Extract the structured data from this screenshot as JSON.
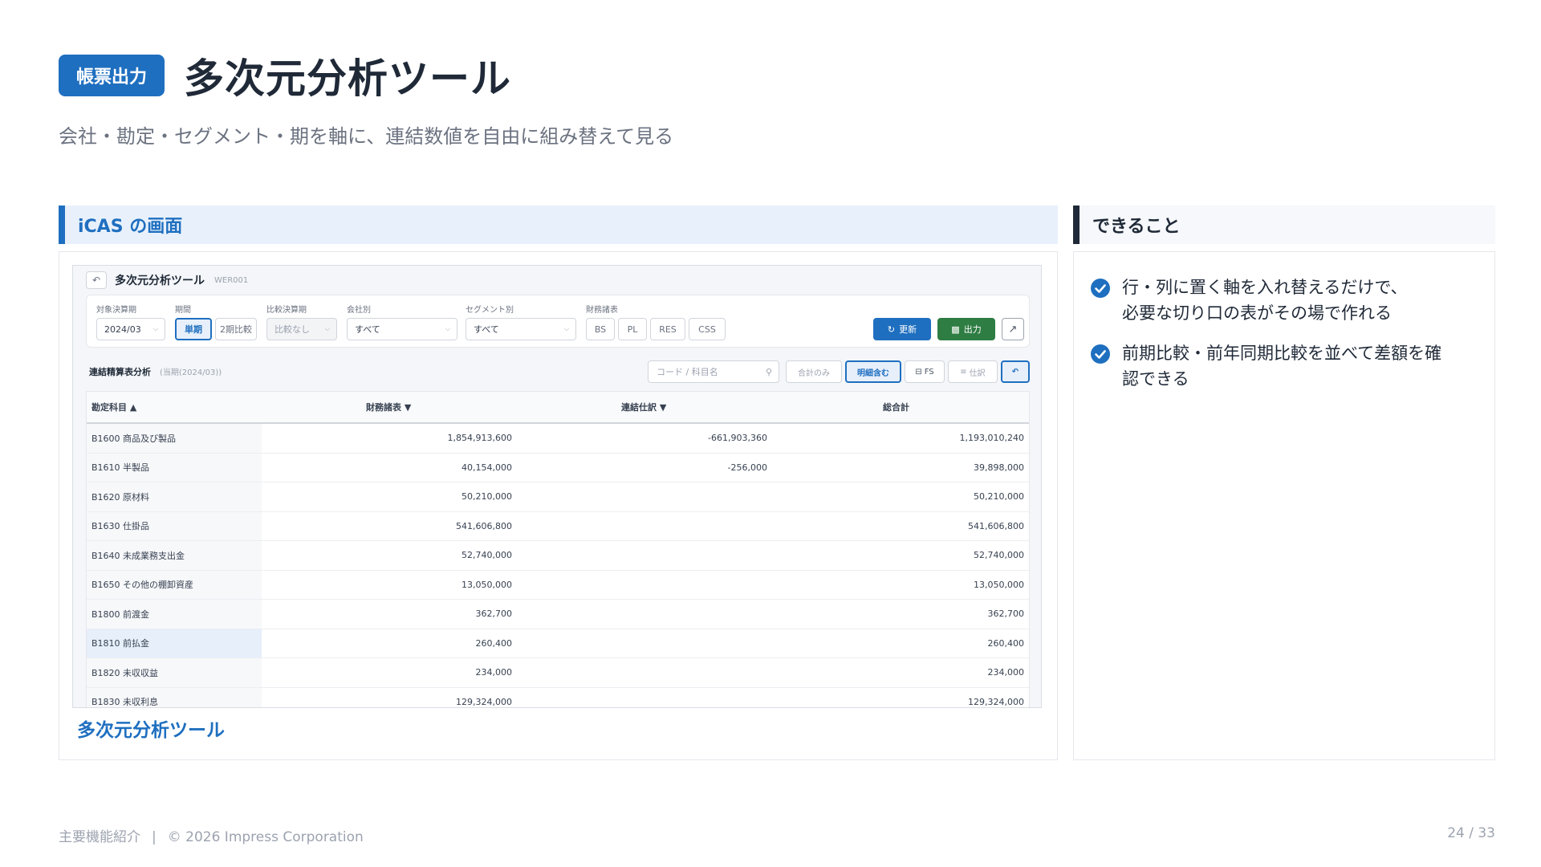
{
  "header": {
    "badge": "帳票出力",
    "title": "多次元分析ツール",
    "subtitle": "会社・勘定・セグメント・期を軸に、連結数値を自由に組み替えて見る"
  },
  "left_panel": {
    "heading": "iCAS の画面",
    "caption": "多次元分析ツール",
    "screenshot": {
      "back_icon": "↶",
      "title": "多次元分析ツール",
      "code": "WER001",
      "filters": {
        "target_label": "対象決算期",
        "target_value": "2024/03",
        "period_label": "期間",
        "period_single": "単期",
        "period_compare": "2期比較",
        "compare_label": "比較決算期",
        "compare_value": "比較なし",
        "company_label": "会社別",
        "company_value": "すべて",
        "segment_label": "セグメント別",
        "segment_value": "すべて",
        "statement_label": "財務諸表",
        "statements": [
          "BS",
          "PL",
          "RES",
          "CSS"
        ],
        "refresh_label": "更新",
        "export_label": "出力"
      },
      "section": {
        "title": "連結精算表分析",
        "subtitle": "(当期(2024/03))",
        "search_placeholder": "コード / 科目名",
        "total_only": "合計のみ",
        "include_detail": "明細含む",
        "fs": "FS",
        "journal": "仕訳"
      },
      "columns": [
        "勘定科目 ▲",
        "財務諸表 ▼",
        "連結仕訳 ▼",
        "総合計"
      ],
      "rows": [
        [
          "B1600 商品及び製品",
          "1,854,913,600",
          "-661,903,360",
          "1,193,010,240"
        ],
        [
          "B1610 半製品",
          "40,154,000",
          "-256,000",
          "39,898,000"
        ],
        [
          "B1620 原材料",
          "50,210,000",
          "",
          "50,210,000"
        ],
        [
          "B1630 仕掛品",
          "541,606,800",
          "",
          "541,606,800"
        ],
        [
          "B1640 未成業務支出金",
          "52,740,000",
          "",
          "52,740,000"
        ],
        [
          "B1650 その他の棚卸資産",
          "13,050,000",
          "",
          "13,050,000"
        ],
        [
          "B1800 前渡金",
          "362,700",
          "",
          "362,700"
        ],
        [
          "B1810 前払金",
          "260,400",
          "",
          "260,400"
        ],
        [
          "B1820 未収収益",
          "234,000",
          "",
          "234,000"
        ],
        [
          "B1830 未収利息",
          "129,324,000",
          "",
          "129,324,000"
        ]
      ]
    }
  },
  "right_panel": {
    "heading": "できること",
    "features": [
      "行・列に置く軸を入れ替えるだけで、\n必要な切り口の表がその場で作れる",
      "前期比較・前年同期比較を並べて差額を確\n認できる"
    ]
  },
  "footer": {
    "section": "主要機能紹介",
    "separator": "|",
    "copyright": "© 2026 Impress Corporation",
    "page": "24 / 33"
  },
  "colors": {
    "accent": "#1f6fc0",
    "export_green": "#2e7d43",
    "text_dark": "#1f2937",
    "text_muted": "#6b7280"
  }
}
